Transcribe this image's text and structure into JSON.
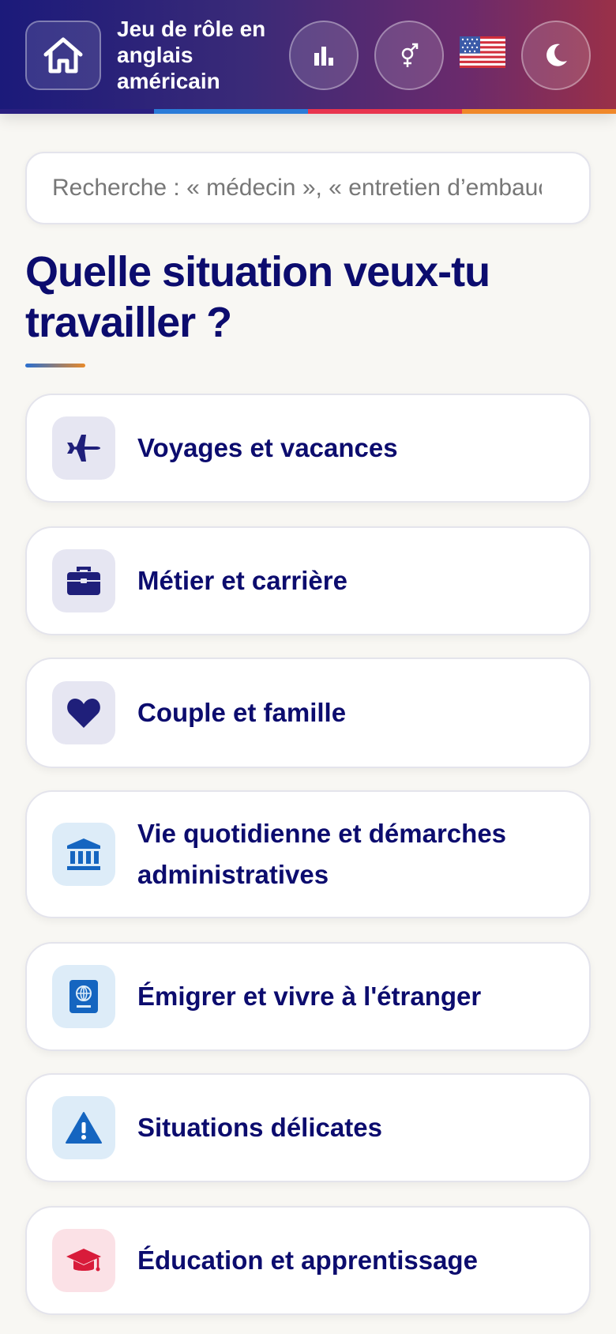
{
  "header": {
    "title": "Jeu de rôle en anglais américain",
    "home_icon": "home-icon",
    "stats_icon": "bar-chart-icon",
    "gender_icon": "gender-icon",
    "flag_icon": "us-flag-icon",
    "theme_icon": "moon-icon",
    "stripe_colors": [
      "#2a6fd0",
      "#2a6fd0",
      "#e83a5a",
      "#f08a2a"
    ]
  },
  "search": {
    "placeholder": "Recherche : « médecin », « entretien d’embauche »"
  },
  "main": {
    "heading": "Quelle situation veux-tu travailler ?"
  },
  "categories": [
    {
      "label": "Voyages et vacances",
      "icon": "airplane-icon",
      "bg": "#e6e6f2",
      "color": "#1f1f7a"
    },
    {
      "label": "Métier et carrière",
      "icon": "briefcase-icon",
      "bg": "#e6e6f2",
      "color": "#1f1f7a"
    },
    {
      "label": "Couple et famille",
      "icon": "heart-icon",
      "bg": "#e6e6f2",
      "color": "#1f1f7a"
    },
    {
      "label": "Vie quotidienne et démarches administratives",
      "icon": "bank-icon",
      "bg": "#ddecf8",
      "color": "#1565c0"
    },
    {
      "label": "Émigrer et vivre à l'étranger",
      "icon": "passport-icon",
      "bg": "#ddecf8",
      "color": "#1565c0"
    },
    {
      "label": "Situations délicates",
      "icon": "warning-icon",
      "bg": "#ddecf8",
      "color": "#1565c0"
    },
    {
      "label": "Éducation et apprentissage",
      "icon": "graduation-cap-icon",
      "bg": "#fbe1e6",
      "color": "#d81b3a"
    }
  ]
}
